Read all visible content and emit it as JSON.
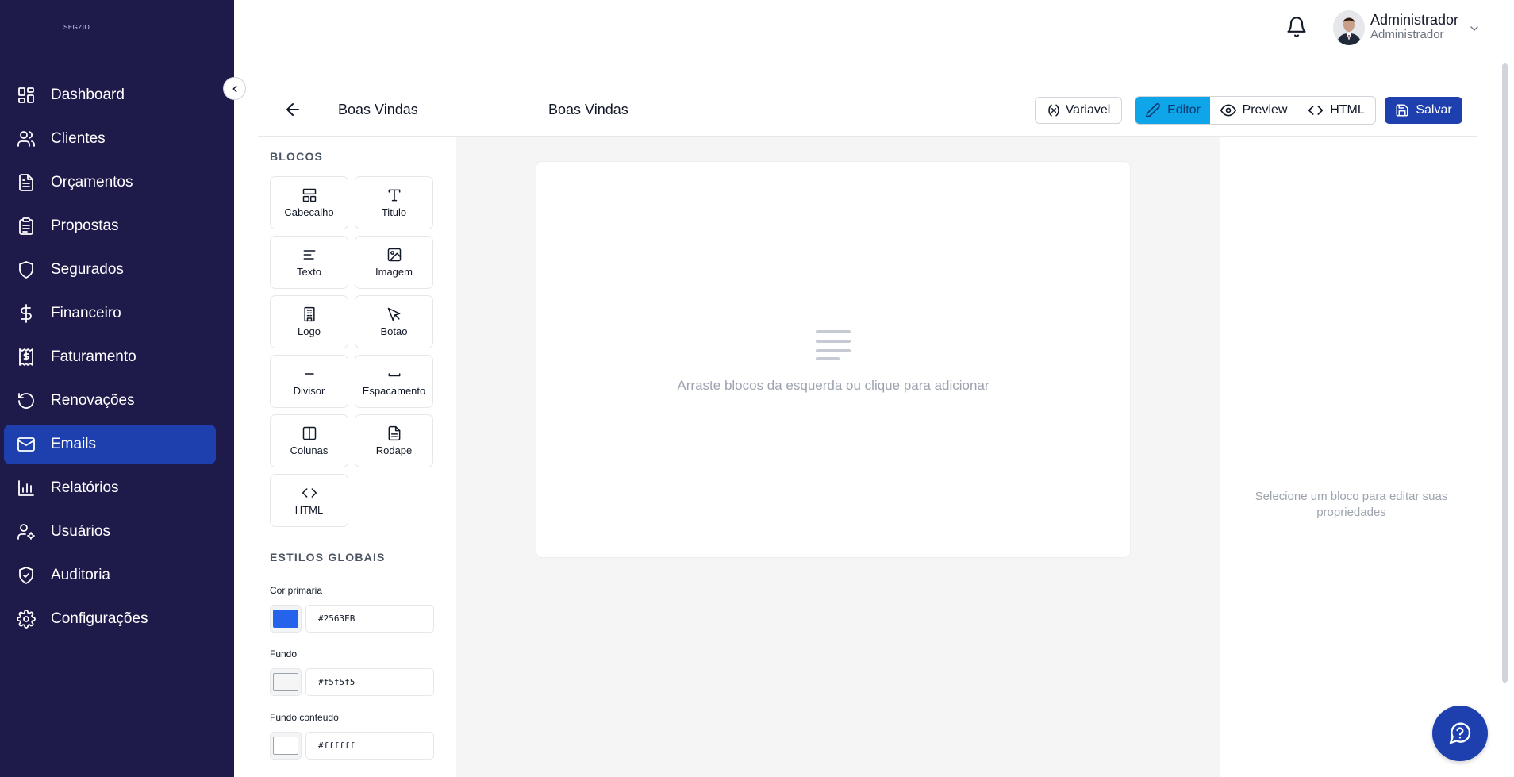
{
  "brand": "SEGZIO",
  "sidebar": {
    "items": [
      {
        "label": "Dashboard",
        "icon": "dashboard-icon"
      },
      {
        "label": "Clientes",
        "icon": "users-icon"
      },
      {
        "label": "Orçamentos",
        "icon": "file-text-icon"
      },
      {
        "label": "Propostas",
        "icon": "clipboard-icon"
      },
      {
        "label": "Segurados",
        "icon": "shield-icon"
      },
      {
        "label": "Financeiro",
        "icon": "dollar-icon"
      },
      {
        "label": "Faturamento",
        "icon": "receipt-icon"
      },
      {
        "label": "Renovações",
        "icon": "rotate-icon"
      },
      {
        "label": "Emails",
        "icon": "mail-icon",
        "active": true
      },
      {
        "label": "Relatórios",
        "icon": "bar-chart-icon"
      },
      {
        "label": "Usuários",
        "icon": "user-cog-icon"
      },
      {
        "label": "Auditoria",
        "icon": "shield-check-icon"
      },
      {
        "label": "Configurações",
        "icon": "settings-icon"
      }
    ],
    "active_color": "#1e40af",
    "bg_color": "#1e1b4b"
  },
  "topbar": {
    "user_name": "Administrador",
    "user_role": "Administrador",
    "icons": [
      "bell-icon",
      "chevron-down-icon"
    ]
  },
  "editor": {
    "template_name": "Boas Vindas",
    "subject": "Boas Vindas",
    "variable_label": "Variavel",
    "modes": {
      "editor": "Editor",
      "preview": "Preview",
      "html": "HTML"
    },
    "active_mode": "editor",
    "save_label": "Salvar"
  },
  "blocks": {
    "title": "BLOCOS",
    "items": [
      {
        "label": "Cabecalho",
        "icon": "layout-header-icon"
      },
      {
        "label": "Titulo",
        "icon": "type-icon"
      },
      {
        "label": "Texto",
        "icon": "align-left-icon"
      },
      {
        "label": "Imagem",
        "icon": "image-icon"
      },
      {
        "label": "Logo",
        "icon": "building-icon"
      },
      {
        "label": "Botao",
        "icon": "pointer-icon"
      },
      {
        "label": "Divisor",
        "icon": "minus-icon"
      },
      {
        "label": "Espacamento",
        "icon": "spacing-icon"
      },
      {
        "label": "Colunas",
        "icon": "columns-icon"
      },
      {
        "label": "Rodape",
        "icon": "file-icon"
      },
      {
        "label": "HTML",
        "icon": "code-icon"
      }
    ]
  },
  "global_styles": {
    "title": "ESTILOS GLOBAIS",
    "primary": {
      "label": "Cor primaria",
      "value": "#2563EB"
    },
    "background": {
      "label": "Fundo",
      "value": "#f5f5f5"
    },
    "content_background": {
      "label": "Fundo conteudo",
      "value": "#ffffff"
    }
  },
  "canvas": {
    "empty_text": "Arraste blocos da esquerda ou clique para adicionar"
  },
  "properties": {
    "hint": "Selecione um bloco para editar suas propriedades"
  }
}
